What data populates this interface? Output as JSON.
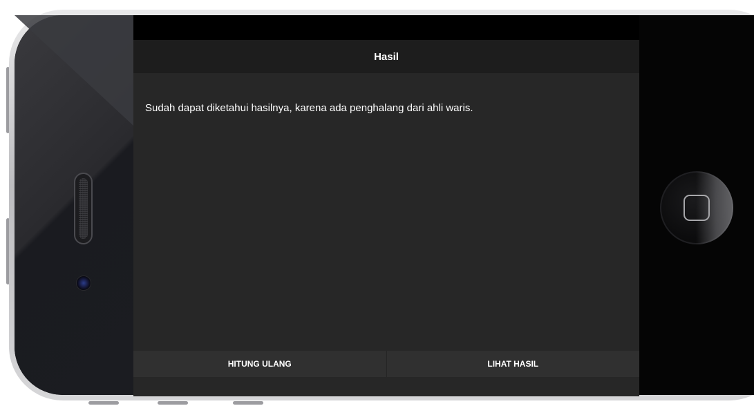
{
  "app": {
    "title": "Hasil"
  },
  "main": {
    "message": "Sudah dapat diketahui hasilnya, karena ada penghalang dari ahli waris."
  },
  "footer": {
    "buttons": [
      {
        "label": "HITUNG ULANG"
      },
      {
        "label": "LIHAT HASIL"
      }
    ]
  },
  "device": {
    "home_button_icon": "square-icon",
    "speaker_icon": "speaker-grille",
    "camera_icon": "camera-lens"
  },
  "colors": {
    "screen_bg": "#272727",
    "header_bg": "#1d1d1d",
    "footer_bg": "#303030",
    "text": "#ffffff"
  }
}
